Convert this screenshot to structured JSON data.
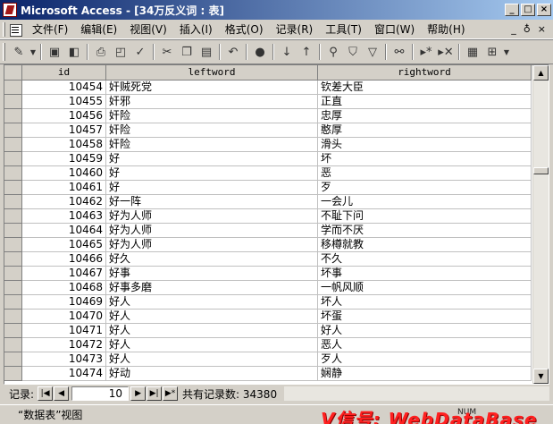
{
  "window": {
    "title": "Microsoft Access - [34万反义词 : 表]"
  },
  "menu": {
    "items": [
      "文件(F)",
      "编辑(E)",
      "视图(V)",
      "插入(I)",
      "格式(O)",
      "记录(R)",
      "工具(T)",
      "窗口(W)",
      "帮助(H)"
    ],
    "doc_min": "_",
    "doc_restore": "♁",
    "doc_close": "×"
  },
  "table": {
    "columns": [
      "id",
      "leftword",
      "rightword"
    ],
    "rows": [
      [
        "10454",
        "奸贼死党",
        "钦差大臣"
      ],
      [
        "10455",
        "奸邪",
        "正直"
      ],
      [
        "10456",
        "奸险",
        "忠厚"
      ],
      [
        "10457",
        "奸险",
        "憨厚"
      ],
      [
        "10458",
        "奸险",
        "滑头"
      ],
      [
        "10459",
        "好",
        "坏"
      ],
      [
        "10460",
        "好",
        "恶"
      ],
      [
        "10461",
        "好",
        "歹"
      ],
      [
        "10462",
        "好一阵",
        "一会儿"
      ],
      [
        "10463",
        "好为人师",
        "不耻下问"
      ],
      [
        "10464",
        "好为人师",
        "学而不厌"
      ],
      [
        "10465",
        "好为人师",
        "移樽就教"
      ],
      [
        "10466",
        "好久",
        "不久"
      ],
      [
        "10467",
        "好事",
        "坏事"
      ],
      [
        "10468",
        "好事多磨",
        "一帆风顺"
      ],
      [
        "10469",
        "好人",
        "坏人"
      ],
      [
        "10470",
        "好人",
        "坏蛋"
      ],
      [
        "10471",
        "好人",
        "好人"
      ],
      [
        "10472",
        "好人",
        "恶人"
      ],
      [
        "10473",
        "好人",
        "歹人"
      ],
      [
        "10474",
        "好动",
        "娴静"
      ]
    ]
  },
  "navigation": {
    "label": "记录:",
    "current": "10",
    "total_label": "共有记录数: 34380"
  },
  "status": {
    "view": "“数据表”视图",
    "num": "NUM",
    "watermark": "V信号: WebDataBase"
  },
  "colors": {
    "title_start": "#0a246a",
    "title_end": "#a6caf0",
    "chrome": "#d4d0c8",
    "watermark": "#ff2020"
  }
}
